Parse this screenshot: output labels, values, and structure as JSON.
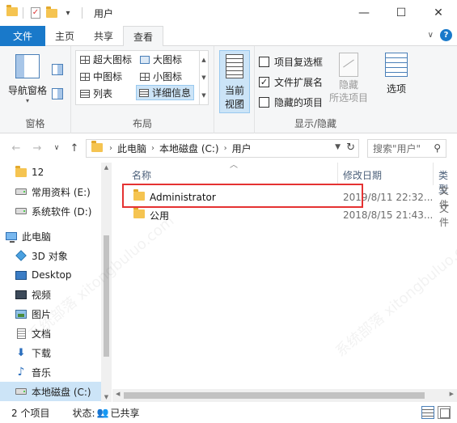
{
  "window": {
    "title": "用户",
    "qa_dropdown": "▾",
    "controls": {
      "minimize": "—",
      "maximize": "☐",
      "close": "✕"
    }
  },
  "tabs": {
    "file": "文件",
    "items": [
      "主页",
      "共享",
      "查看"
    ],
    "active": "查看",
    "collapse": "∨",
    "help": "?"
  },
  "ribbon": {
    "panes": {
      "label": "窗格",
      "nav_pane": "导航窗格"
    },
    "layout": {
      "label": "布局",
      "items": [
        "超大图标",
        "大图标",
        "中图标",
        "小图标",
        "列表",
        "详细信息"
      ],
      "selected": "详细信息"
    },
    "current_view": {
      "sort_label_1": "当前",
      "sort_label_2": "视图"
    },
    "show_hide": {
      "label": "显示/隐藏",
      "item_checkboxes": "项目复选框",
      "file_extensions": "文件扩展名",
      "hidden_items": "隐藏的项目",
      "item_checkboxes_checked": false,
      "file_extensions_checked": true,
      "hidden_items_checked": false,
      "hide_selected_1": "隐藏",
      "hide_selected_2": "所选项目",
      "options": "选项"
    }
  },
  "address": {
    "back": "←",
    "forward": "→",
    "recent": "∨",
    "up": "↑",
    "breadcrumb": [
      "此电脑",
      "本地磁盘 (C:)",
      "用户"
    ],
    "search_placeholder": "搜索\"用户\""
  },
  "nav_pane": {
    "items": [
      {
        "label": "12",
        "icon": "folder-icon"
      },
      {
        "label": "常用资料 (E:)",
        "icon": "drive-icon"
      },
      {
        "label": "系统软件 (D:)",
        "icon": "drive-icon"
      },
      {
        "label": "此电脑",
        "icon": "pc-icon"
      },
      {
        "label": "3D 对象",
        "icon": "3d-objects-icon"
      },
      {
        "label": "Desktop",
        "icon": "desktop-icon"
      },
      {
        "label": "视频",
        "icon": "video-icon"
      },
      {
        "label": "图片",
        "icon": "pictures-icon"
      },
      {
        "label": "文档",
        "icon": "documents-icon"
      },
      {
        "label": "下载",
        "icon": "download-icon"
      },
      {
        "label": "音乐",
        "icon": "music-icon"
      },
      {
        "label": "本地磁盘 (C:)",
        "icon": "drive-icon"
      }
    ]
  },
  "file_list": {
    "columns": [
      "名称",
      "修改日期",
      "类型"
    ],
    "rows": [
      {
        "name": "Administrator",
        "modified": "2019/8/11 22:32...",
        "type": "文件"
      },
      {
        "name": "公用",
        "modified": "2018/8/15 21:43...",
        "type": "文件"
      }
    ]
  },
  "status_bar": {
    "count": "2 个项目",
    "state_label": "状态:",
    "state_value": "已共享"
  },
  "watermark": "系统部落 xitongbuluo.com"
}
